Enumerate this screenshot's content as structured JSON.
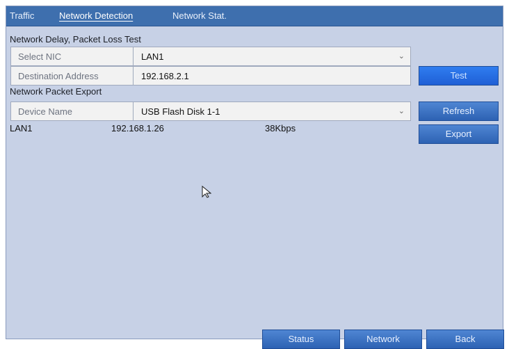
{
  "tabs": [
    {
      "label": "Traffic"
    },
    {
      "label": "Network Detection"
    },
    {
      "label": "Network Stat."
    }
  ],
  "delay_test": {
    "title": "Network Delay, Packet Loss Test",
    "select_nic_label": "Select NIC",
    "select_nic_value": "LAN1",
    "destination_label": "Destination Address",
    "destination_value": "192.168.2.1",
    "test_button": "Test"
  },
  "packet_export": {
    "title": "Network Packet Export",
    "device_name_label": "Device Name",
    "device_name_value": "USB Flash Disk 1-1",
    "refresh_button": "Refresh",
    "export_button": "Export"
  },
  "interfaces": [
    {
      "name": "LAN1",
      "ip": "192.168.1.26",
      "rate": "38Kbps"
    }
  ],
  "footer": {
    "status": "Status",
    "network": "Network",
    "back": "Back"
  }
}
